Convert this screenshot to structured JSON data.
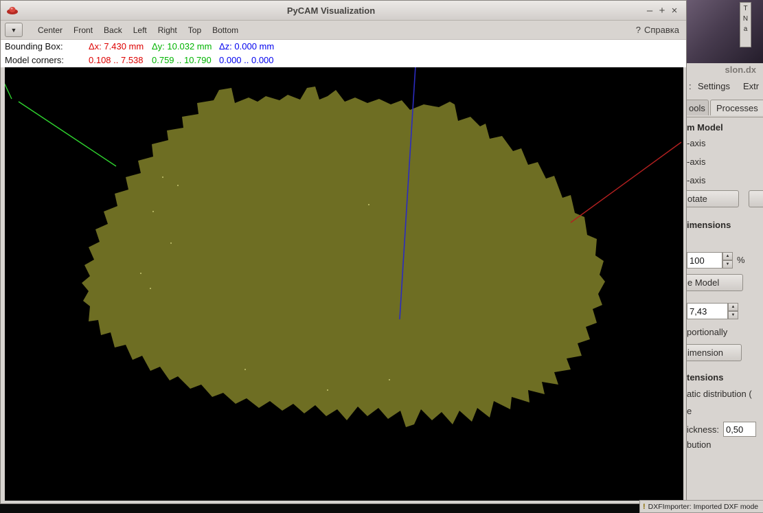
{
  "titlebar": {
    "title": "PyCAM Visualization",
    "minimize": "–",
    "maximize": "+",
    "close": "×"
  },
  "toolbar": {
    "dropdown": "▼",
    "buttons": [
      "Center",
      "Front",
      "Back",
      "Left",
      "Right",
      "Top",
      "Bottom"
    ],
    "help_icon": "?",
    "help_label": "Справка"
  },
  "infobar": {
    "bbox_label": "Bounding Box:",
    "dx": "Δx: 7.430 mm",
    "dy": "Δy: 10.032 mm",
    "dz": "Δz: 0.000 mm",
    "corners_label": "Model corners:",
    "x_range": "0.108 .. 7.538",
    "y_range": "0.759 .. 10.790",
    "z_range": "0.000 .. 0.000"
  },
  "viewport": {
    "model_color": "#6e6e23",
    "x_axis_color": "#b42020",
    "y_axis_color": "#2fd32f",
    "z_axis_color": "#2b2bc0"
  },
  "side_window": {
    "title": "slon.dx",
    "menu_colon": ":",
    "menu": [
      "Settings",
      "Extr"
    ],
    "tabs": [
      "ools",
      "Processes"
    ],
    "sections": {
      "model": "m Model",
      "dimensions": "imensions",
      "extensions": "tensions"
    },
    "axes": [
      "-axis",
      "-axis",
      "-axis"
    ],
    "rotate_button": "otate",
    "scale_percent": "100",
    "percent_sign": "%",
    "scale_model_button": "e Model",
    "dimension_value": "7,43",
    "proportionally": "portionally",
    "dimension_button": "imension",
    "auto_distribution": "atic distribution (",
    "e_fragment": "e",
    "thickness_label": "ickness:",
    "thickness_value": "0,50",
    "distribution_fragment": "bution"
  },
  "statusbar": {
    "icon": "!",
    "text": "DXFImporter: Imported DXF mode"
  },
  "side_panel": {
    "letters": [
      "T",
      "N",
      "a"
    ]
  }
}
